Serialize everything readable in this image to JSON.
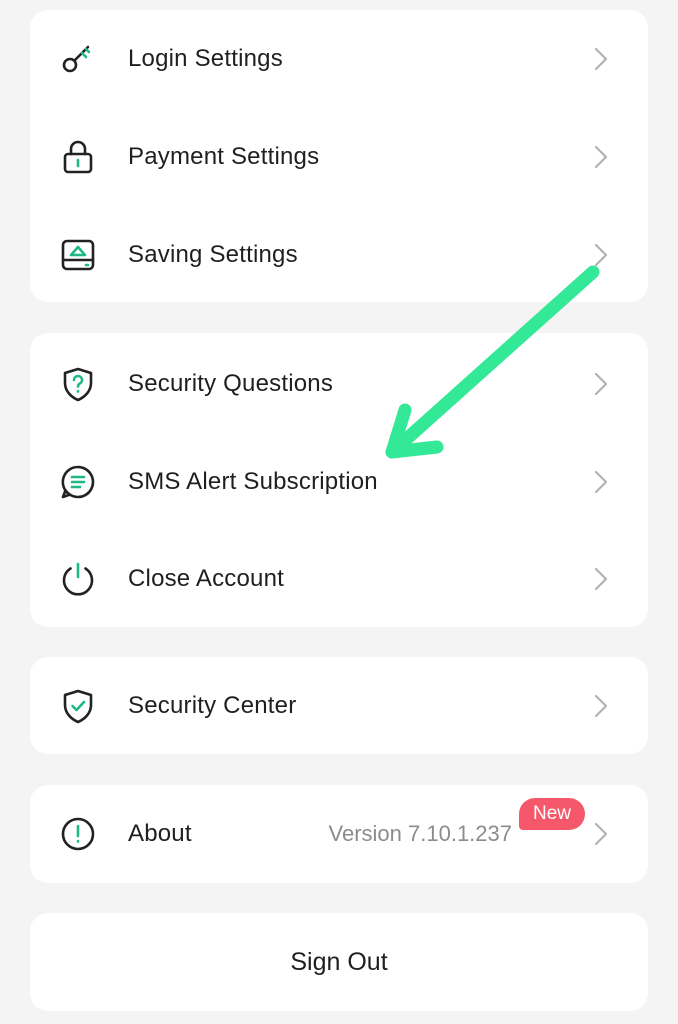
{
  "groups": [
    {
      "items": [
        {
          "icon": "key-icon",
          "label": "Login Settings"
        },
        {
          "icon": "lock-icon",
          "label": "Payment Settings"
        },
        {
          "icon": "savings-icon",
          "label": "Saving Settings"
        }
      ]
    },
    {
      "items": [
        {
          "icon": "shield-question-icon",
          "label": "Security Questions"
        },
        {
          "icon": "message-icon",
          "label": "SMS Alert Subscription"
        },
        {
          "icon": "power-icon",
          "label": "Close Account"
        }
      ]
    },
    {
      "items": [
        {
          "icon": "shield-check-icon",
          "label": "Security Center"
        }
      ]
    }
  ],
  "about": {
    "icon": "info-icon",
    "label": "About",
    "version": "Version 7.10.1.237",
    "badge": "New"
  },
  "sign_out": {
    "label": "Sign Out"
  },
  "colors": {
    "accent": "#1fb981",
    "annotation_arrow": "#33e896",
    "badge": "#f5586a",
    "background": "#f4f4f4"
  }
}
